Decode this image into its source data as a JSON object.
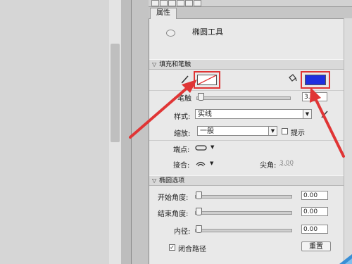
{
  "panel": {
    "tab_label": "属性",
    "tool_name": "椭圆工具"
  },
  "fill_stroke": {
    "section_title": "填充和笔触",
    "stroke_label": "笔触",
    "stroke_value": "3.00",
    "style_label": "样式:",
    "style_value": "实线",
    "scale_label": "缩放:",
    "scale_value": "一般",
    "hint_label": "提示",
    "cap_label": "端点:",
    "join_label": "接合:",
    "miter_label": "尖角:",
    "miter_value": "3.00",
    "fill_color": "#1f2fe0",
    "stroke_color": "#ffffff"
  },
  "ellipse_options": {
    "section_title": "椭圆选项",
    "start_angle_label": "开始角度:",
    "start_angle_value": "0.00",
    "end_angle_label": "结束角度:",
    "end_angle_value": "0.00",
    "inner_radius_label": "内径:",
    "inner_radius_value": "0.00",
    "close_path_label": "闭合路径",
    "close_path_checked": true,
    "reset_label": "重置"
  },
  "annotation_color": "#e03535"
}
